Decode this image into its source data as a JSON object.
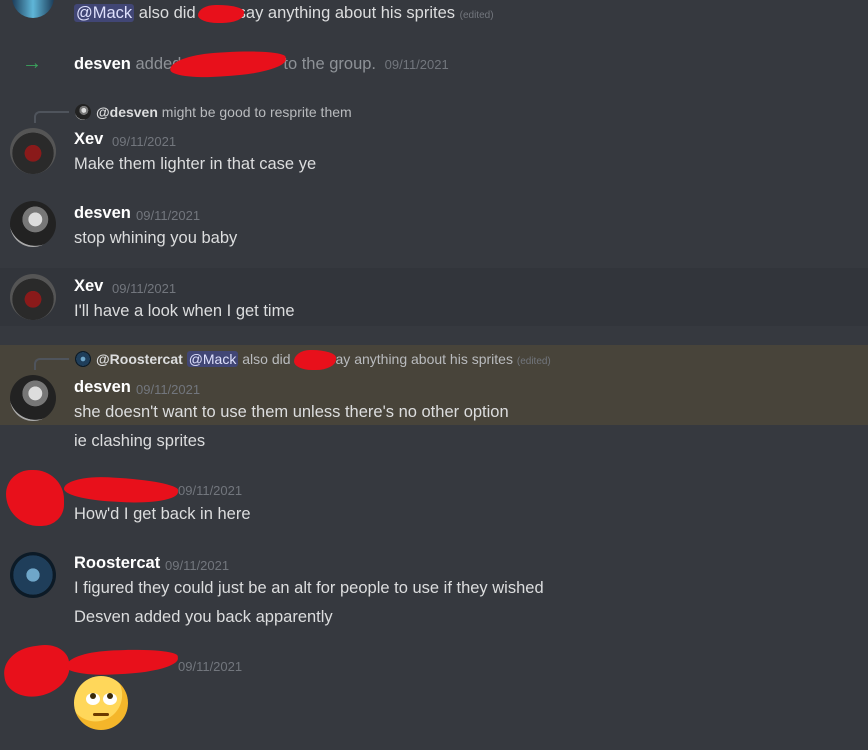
{
  "top": {
    "mention": "@Mack",
    "text_a": "also did",
    "text_b": "say anything about his sprites",
    "edited": "(edited)"
  },
  "system": {
    "actor": "desven",
    "text_a": "added",
    "text_b": "to the group.",
    "timestamp": "09/11/2021"
  },
  "reply1": {
    "name": "@desven",
    "text": "might be good to resprite them"
  },
  "messages": {
    "m1": {
      "author": "Xev",
      "timestamp": "09/11/2021",
      "text": "Make them lighter in that case ye"
    },
    "m2": {
      "author": "desven",
      "timestamp": "09/11/2021",
      "text": "stop whining you baby"
    },
    "m3": {
      "author": "Xev",
      "timestamp": "09/11/2021",
      "text": "I'll have a look when I get time"
    },
    "m4": {
      "author": "desven",
      "timestamp": "09/11/2021",
      "text": "she doesn't want to use them unless there's no other option",
      "text2": "ie clashing sprites"
    },
    "m5": {
      "timestamp": "09/11/2021",
      "text": "How'd I get back in here"
    },
    "m6": {
      "author": "Roostercat",
      "timestamp": "09/11/2021",
      "text": "I figured they could just be an alt for people to use if they wished",
      "text2": "Desven added you back apparently"
    },
    "m7": {
      "timestamp": "09/11/2021",
      "emoji": "face-with-rolling-eyes"
    }
  },
  "reply2": {
    "name": "@Roostercat",
    "mention": "@Mack",
    "text_a": "also did",
    "text_b": "say anything about his sprites",
    "edited": "(edited)"
  },
  "colors": {
    "background": "#36393f",
    "highlight": "#48443a",
    "mention_bg": "#414675",
    "redaction": "#e8101b",
    "join_arrow": "#3ba55d"
  }
}
